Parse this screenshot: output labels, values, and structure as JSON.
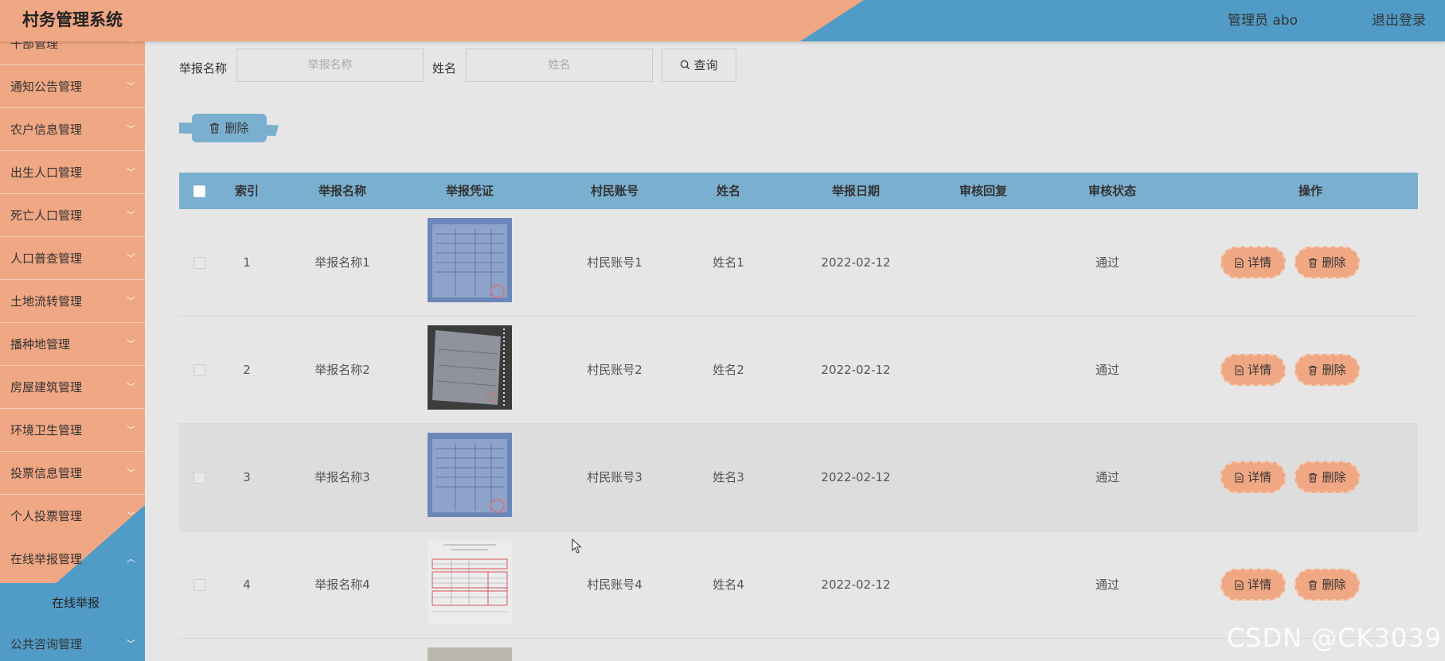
{
  "header": {
    "title": "村务管理系统",
    "user": "管理员 abo",
    "logout": "退出登录"
  },
  "sidebar": {
    "items": [
      {
        "label": "干部管理"
      },
      {
        "label": "通知公告管理"
      },
      {
        "label": "农户信息管理"
      },
      {
        "label": "出生人口管理"
      },
      {
        "label": "死亡人口管理"
      },
      {
        "label": "人口普查管理"
      },
      {
        "label": "土地流转管理"
      },
      {
        "label": "播种地管理"
      },
      {
        "label": "房屋建筑管理"
      },
      {
        "label": "环境卫生管理"
      },
      {
        "label": "投票信息管理"
      },
      {
        "label": "个人投票管理"
      },
      {
        "label": "在线举报管理"
      },
      {
        "label": "公共咨询管理"
      }
    ],
    "sub_item": "在线举报",
    "chevron": "chevron-down-icon"
  },
  "search": {
    "label1": "举报名称",
    "placeholder1": "举报名称",
    "label2": "姓名",
    "placeholder2": "姓名",
    "query": "查询"
  },
  "toolbar": {
    "delete": "删除"
  },
  "table": {
    "headers": [
      "索引",
      "举报名称",
      "举报凭证",
      "村民账号",
      "姓名",
      "举报日期",
      "审核回复",
      "审核状态",
      "操作"
    ],
    "rows": [
      {
        "index": "1",
        "name": "举报名称1",
        "account": "村民账号1",
        "person": "姓名1",
        "date": "2022-02-12",
        "reply": "",
        "status": "通过"
      },
      {
        "index": "2",
        "name": "举报名称2",
        "account": "村民账号2",
        "person": "姓名2",
        "date": "2022-02-12",
        "reply": "",
        "status": "通过"
      },
      {
        "index": "3",
        "name": "举报名称3",
        "account": "村民账号3",
        "person": "姓名3",
        "date": "2022-02-12",
        "reply": "",
        "status": "通过"
      },
      {
        "index": "4",
        "name": "举报名称4",
        "account": "村民账号4",
        "person": "姓名4",
        "date": "2022-02-12",
        "reply": "",
        "status": "通过"
      }
    ],
    "actions": {
      "detail": "详情",
      "delete": "删除"
    }
  },
  "watermark": "CSDN @CK3039",
  "colors": {
    "peach": "#f0a783",
    "blue": "#519bc7",
    "table_header": "#7bafd0",
    "background": "#e6e6e6"
  }
}
